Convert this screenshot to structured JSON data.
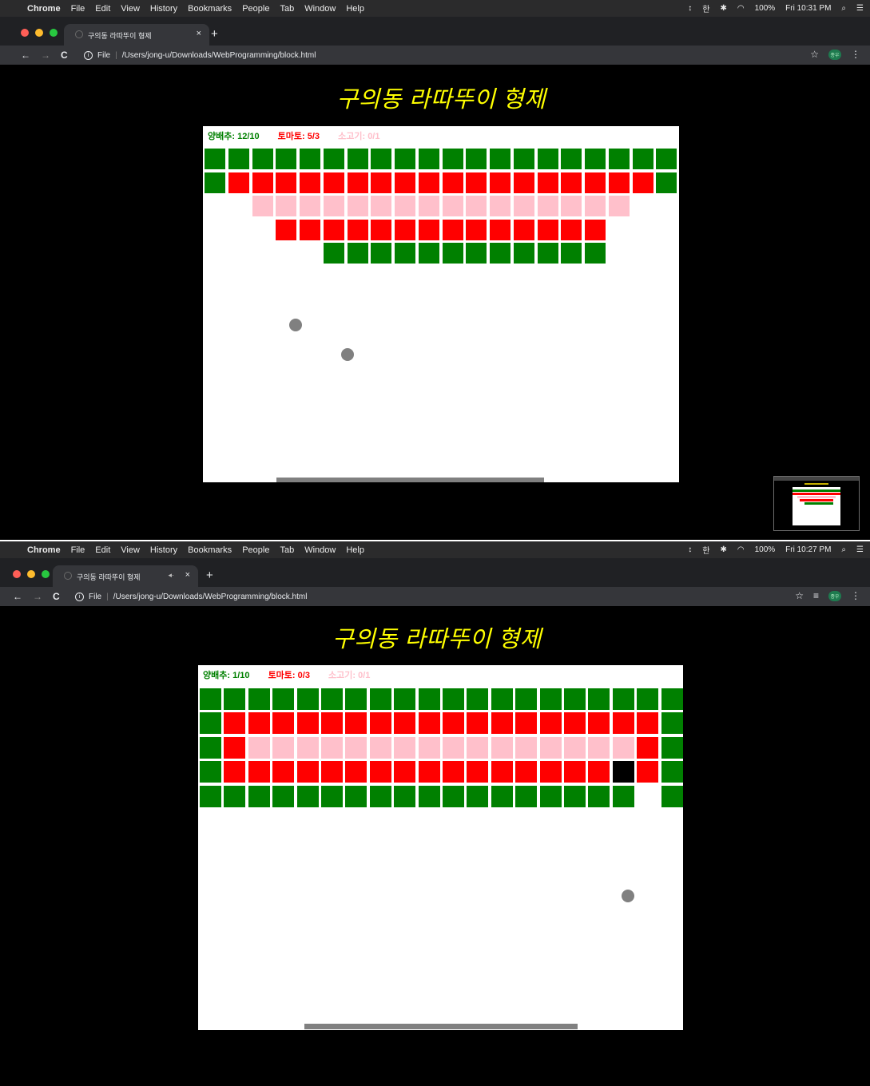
{
  "menubar": {
    "apple": "",
    "items": [
      "Chrome",
      "File",
      "Edit",
      "View",
      "History",
      "Bookmarks",
      "People",
      "Tab",
      "Window",
      "Help"
    ],
    "status": {
      "battery": "100%",
      "input": "한",
      "time_1": "Fri 10:31 PM",
      "time_2": "Fri 10:27 PM"
    }
  },
  "tab": {
    "title": "구의동 라따뚜이 형제",
    "close": "×",
    "audio": "◂·",
    "new": "+"
  },
  "toolbar": {
    "back": "←",
    "forward": "→",
    "reload": "C",
    "scheme": "File",
    "url": "/Users/jong-u/Downloads/WebProgramming/block.html",
    "star": "☆",
    "avatar": "종우"
  },
  "page": {
    "title": "구의동 라따뚜이 형제"
  },
  "game1": {
    "cabbage": "양배추: 12/10",
    "tomato": "토마토: 5/3",
    "beef": "소고기: 0/1"
  },
  "game2": {
    "cabbage": "양배추: 1/10",
    "tomato": "토마토: 0/3",
    "beef": "소고기: 0/1"
  },
  "colors": {
    "cabbage": "#008000",
    "tomato": "#ff0000",
    "beef": "#ffc0cb",
    "black": "#000000",
    "ball": "#808080",
    "title": "#ffff00"
  },
  "rows1": [
    "GGGGGGGGGGGGGGGGGGGG",
    "GRRRRRRRRRRRRRRRRRRG",
    "..PPPPPPPPPPPPPPPP..",
    "...RRRRRRRRRRRRRR...",
    ".....GGGGGGGGGGGG..."
  ],
  "rows2": [
    "GGGGGGGGGGGGGGGGGGGG",
    "GRRRRRRRRRRRRRRRRRRG",
    "GRPPPPPPPPPPPPPPPPRG",
    "GRRRRRRRRRRRRRRRRKRG",
    "GGGGGGGGGGGGGGGGGG.G"
  ]
}
